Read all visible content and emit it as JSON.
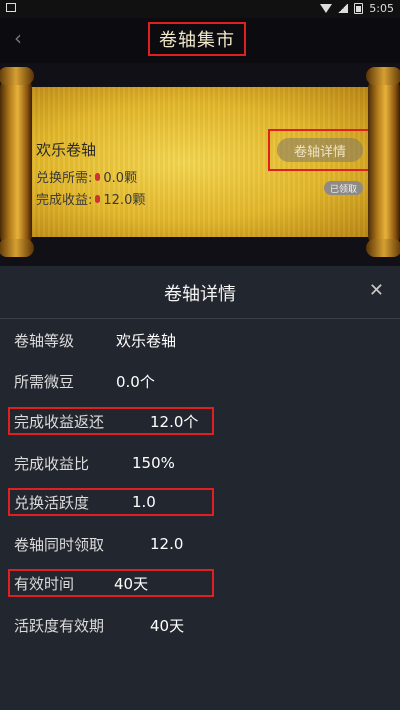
{
  "statusbar": {
    "time": "5:05"
  },
  "header": {
    "title": "卷轴集市",
    "back_icon": "chevron-left-icon"
  },
  "scroll_card": {
    "name": "欢乐卷轴",
    "cost_label": "兑换所需:",
    "cost_value": "0.0颗",
    "income_label": "完成收益:",
    "income_value": "12.0颗",
    "detail_button": "卷轴详情",
    "claimed_badge": "已领取"
  },
  "detail_sheet": {
    "title": "卷轴详情",
    "rows": [
      {
        "label": "卷轴等级",
        "value": "欢乐卷轴"
      },
      {
        "label": "所需微豆",
        "value": "0.0个"
      },
      {
        "label": "完成收益返还",
        "value": "12.0个"
      },
      {
        "label": "完成收益比",
        "value": "150%"
      },
      {
        "label": "兑换活跃度",
        "value": "1.0"
      },
      {
        "label": "卷轴同时领取",
        "value": "12.0"
      },
      {
        "label": "有效时间",
        "value": "40天"
      },
      {
        "label": "活跃度有效期",
        "value": "40天"
      }
    ]
  },
  "colors": {
    "highlight": "#e02020",
    "sheet_bg": "#22262e",
    "scroll_gold": "#e3b72a"
  }
}
